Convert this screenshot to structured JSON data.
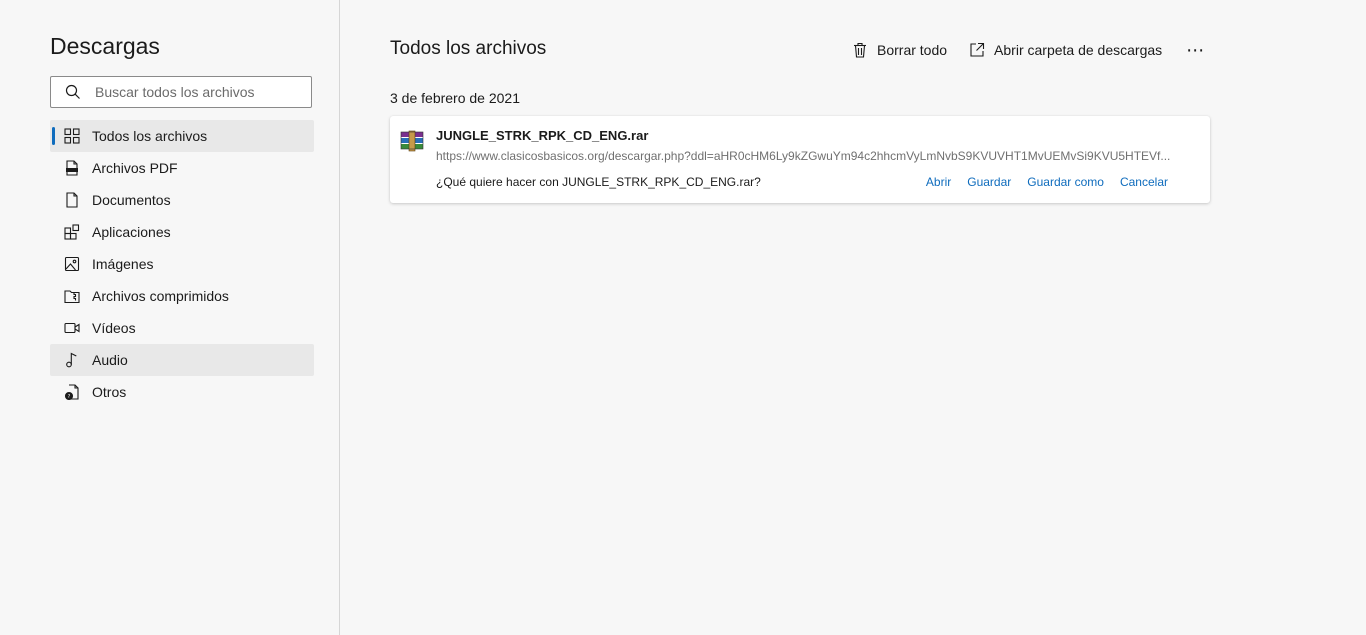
{
  "sidebar": {
    "title": "Descargas",
    "search": {
      "placeholder": "Buscar todos los archivos",
      "value": ""
    },
    "items": [
      {
        "label": "Todos los archivos",
        "icon": "grid-icon",
        "state": "active"
      },
      {
        "label": "Archivos PDF",
        "icon": "pdf-icon"
      },
      {
        "label": "Documentos",
        "icon": "document-icon"
      },
      {
        "label": "Aplicaciones",
        "icon": "apps-icon"
      },
      {
        "label": "Imágenes",
        "icon": "image-icon"
      },
      {
        "label": "Archivos comprimidos",
        "icon": "archive-icon"
      },
      {
        "label": "Vídeos",
        "icon": "video-icon"
      },
      {
        "label": "Audio",
        "icon": "music-icon",
        "state": "hover"
      },
      {
        "label": "Otros",
        "icon": "other-file-icon"
      }
    ]
  },
  "main": {
    "title": "Todos los archivos",
    "toolbar": {
      "clear_all": "Borrar todo",
      "open_folder": "Abrir carpeta de descargas",
      "more": "⋯"
    },
    "groups": [
      {
        "date": "3 de febrero de 2021",
        "downloads": [
          {
            "filename": "JUNGLE_STRK_RPK_CD_ENG.rar",
            "url": "https://www.clasicosbasicos.org/descargar.php?ddl=aHR0cHM6Ly9kZGwuYm94c2hhcmVyLmNvbS9KVUVHT1MvUEMvSi9KVU5HTEVf...",
            "prompt": "¿Qué quiere hacer con JUNGLE_STRK_RPK_CD_ENG.rar?",
            "actions": {
              "open": "Abrir",
              "save": "Guardar",
              "save_as": "Guardar como",
              "cancel": "Cancelar"
            }
          }
        ]
      }
    ]
  },
  "colors": {
    "accent": "#0f6cbd",
    "background": "#f7f7f7",
    "card": "#ffffff",
    "muted_text": "#707070"
  }
}
